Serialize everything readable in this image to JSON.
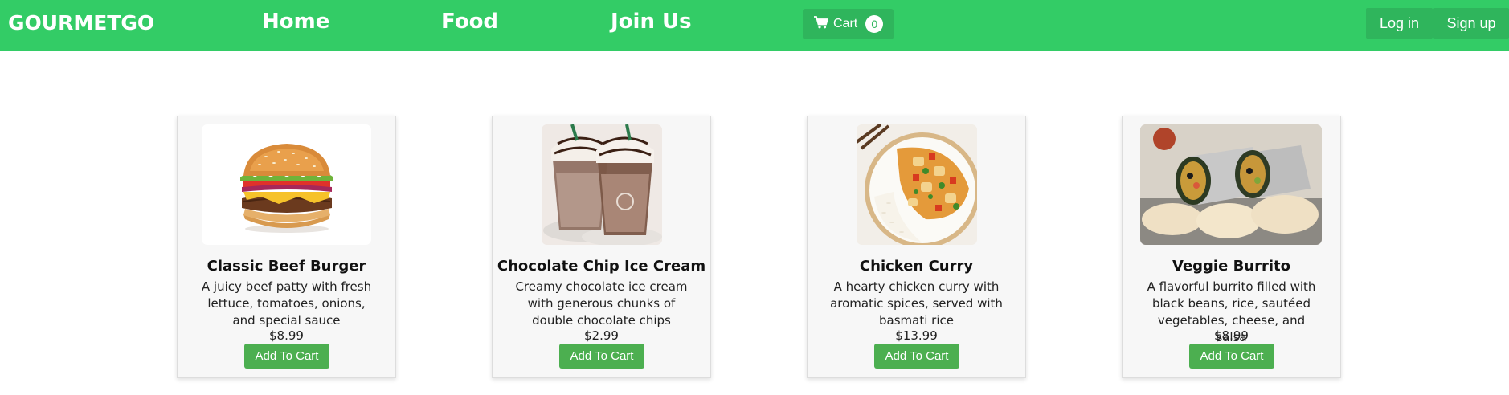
{
  "navbar": {
    "brand": "GOURMETGO",
    "links": [
      "Home",
      "Food",
      "Join Us"
    ],
    "cart": {
      "label": "Cart",
      "count": "0",
      "icon": "cart-icon"
    },
    "login_label": "Log in",
    "signup_label": "Sign up",
    "colors": {
      "bar": "#33cc66",
      "button": "#2fb55c"
    }
  },
  "products": [
    {
      "name": "Classic Beef Burger",
      "description": "A juicy beef patty with fresh lettuce, tomatoes, onions, and special sauce",
      "price": "$8.99",
      "button": "Add To Cart",
      "image": "burger-image"
    },
    {
      "name": "Chocolate Chip Ice Cream",
      "description": "Creamy chocolate ice cream with generous chunks of double chocolate chips",
      "price": "$2.99",
      "button": "Add To Cart",
      "image": "ice-cream-image"
    },
    {
      "name": "Chicken Curry",
      "description": "A hearty chicken curry with aromatic spices, served with basmati rice",
      "price": "$13.99",
      "button": "Add To Cart",
      "image": "chicken-curry-image"
    },
    {
      "name": "Veggie Burrito",
      "description": "A flavorful burrito filled with black beans, rice, sautéed vegetables, cheese, and salsa",
      "price": "$8.99",
      "button": "Add To Cart",
      "image": "burrito-image"
    }
  ],
  "accent": "#4caf50"
}
